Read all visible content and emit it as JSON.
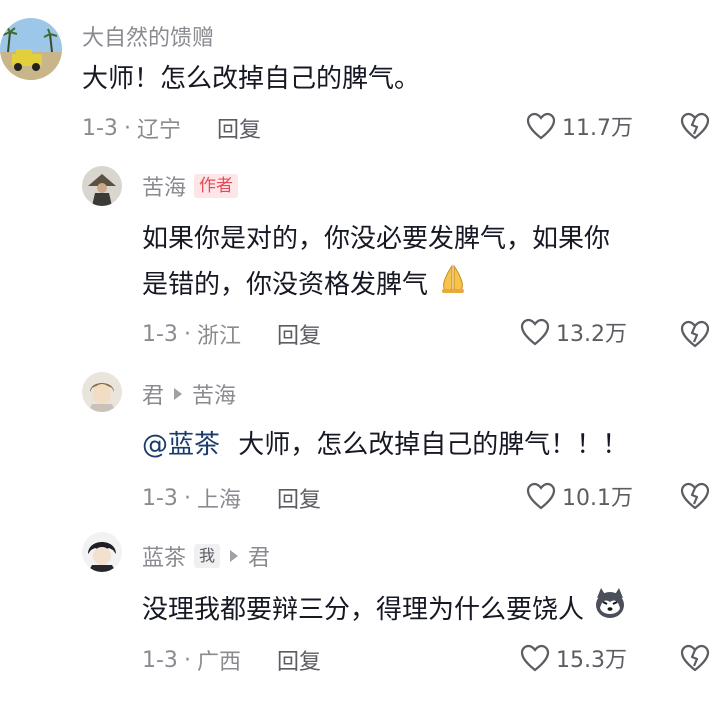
{
  "comments": [
    {
      "username": "大自然的馈赠",
      "text": "大师！怎么改掉自己的脾气。",
      "date": "1-3",
      "location": "辽宁",
      "reply_label": "回复",
      "likes": "11.7万"
    },
    {
      "username": "苦海",
      "badge": "作者",
      "text_line1": "如果你是对的，你没必要发脾气，如果你",
      "text_line2": "是错的，你没资格发脾气",
      "emoji": "praying-hands",
      "date": "1-3",
      "location": "浙江",
      "reply_label": "回复",
      "likes": "13.2万"
    },
    {
      "username": "君",
      "reply_to": "苦海",
      "mention": "@蓝茶",
      "text": "大师，怎么改掉自己的脾气！！！",
      "date": "1-3",
      "location": "上海",
      "reply_label": "回复",
      "likes": "10.1万"
    },
    {
      "username": "蓝茶",
      "badge": "我",
      "reply_to": "君",
      "text": "没理我都要辩三分，得理为什么要饶人",
      "emoji": "husky-face",
      "date": "1-3",
      "location": "广西",
      "reply_label": "回复",
      "likes": "15.3万"
    }
  ],
  "colors": {
    "text": "#161823",
    "meta": "#8a8b91",
    "author_badge_bg": "#fde6e7",
    "author_badge_text": "#ea4a56",
    "mention": "#1a3b6b"
  },
  "icons": {
    "like": "heart-outline-icon",
    "dislike": "broken-heart-icon"
  }
}
